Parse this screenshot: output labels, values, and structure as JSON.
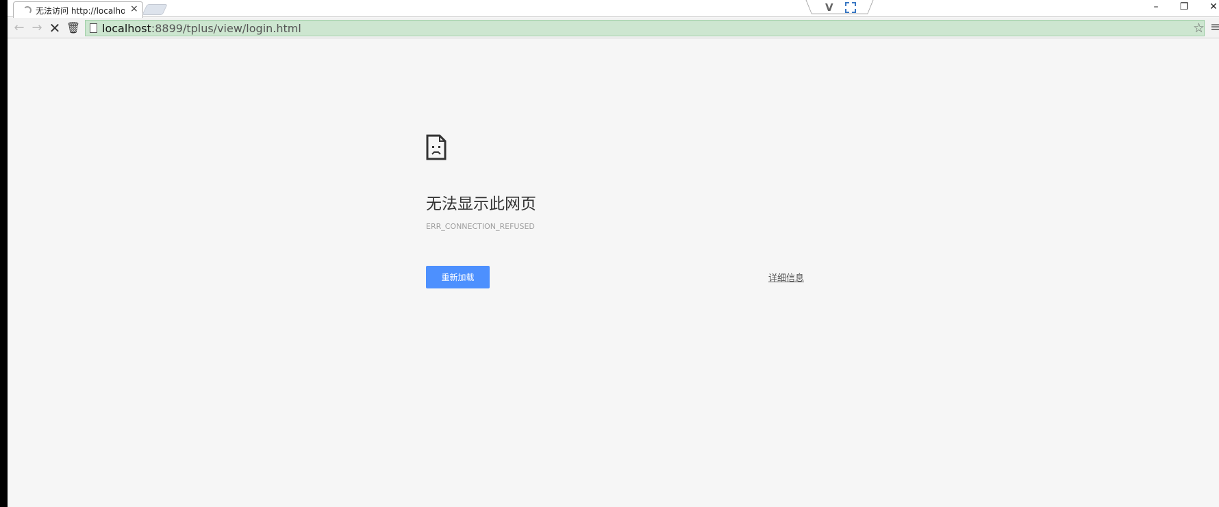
{
  "tab": {
    "title": "无法访问 http://localhost",
    "close_glyph": "×"
  },
  "window_controls": {
    "minimize": "–",
    "restore": "❐",
    "close": "✕"
  },
  "toolbar": {
    "back_glyph": "←",
    "forward_glyph": "→",
    "stop_glyph": "✕",
    "trash_glyph": "🗑",
    "star_glyph": "☆",
    "menu_glyph": "≡"
  },
  "omnibox": {
    "url_host": "localhost",
    "url_rest": ":8899/tplus/view/login.html"
  },
  "extension": {
    "v_glyph": "V"
  },
  "error": {
    "title": "无法显示此网页",
    "code": "ERR_CONNECTION_REFUSED",
    "reload_label": "重新加载",
    "details_label": "详细信息"
  },
  "colors": {
    "omnibox_bg": "#cde6d0",
    "reload_button": "#4d90fe",
    "page_bg": "#f6f6f6"
  }
}
